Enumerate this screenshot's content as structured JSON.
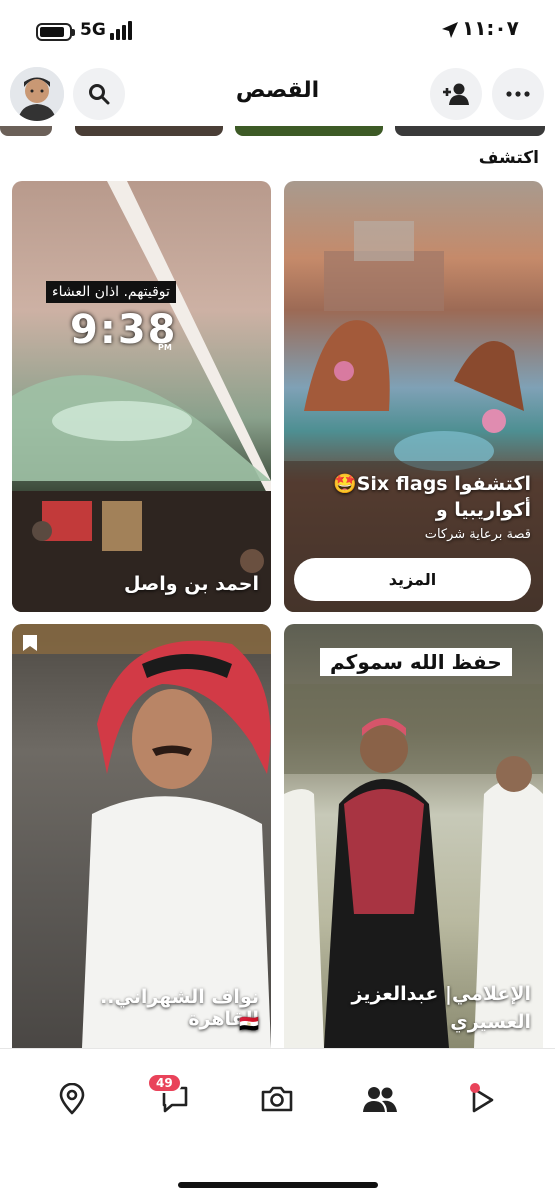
{
  "status_bar": {
    "network": "5G",
    "time": "١١:٠٧",
    "battery_level": 0.72
  },
  "header": {
    "title": "القصص"
  },
  "section_label": "اكتشف",
  "cards": [
    {
      "headline": "اكتشفوا Six flags🤩 أكواريبيا و",
      "sponsor": "قصة برعاية شركات",
      "cta": "المزيد"
    },
    {
      "overlay_label": "توقيتهم. اذان العشاء",
      "overlay_time": "9:38",
      "overlay_suffix": "PM",
      "caption": "احمد بن واصل"
    },
    {
      "overlay_label": "حفظ الله سموكم",
      "caption": "الإعلامي| عبدالعزيز العسيري"
    },
    {
      "caption": "نواف الشهراني.. القاهرة",
      "flag": "🇪🇬"
    }
  ],
  "nav": {
    "chat_badge": "49"
  },
  "icons": [
    "search-icon",
    "add-friend-icon",
    "more-icon",
    "map-pin-icon",
    "chat-icon",
    "camera-icon",
    "friends-icon",
    "play-icon",
    "bookmark-icon"
  ],
  "colors": {
    "badge": "#e9435a",
    "button_bg": "#f0f1f3"
  }
}
